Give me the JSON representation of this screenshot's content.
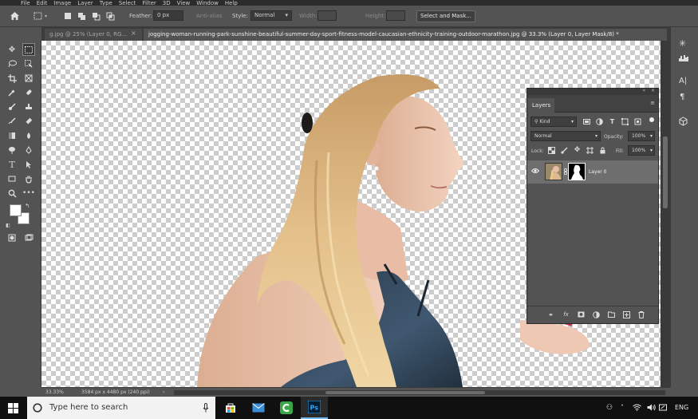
{
  "menu": [
    "File",
    "Edit",
    "Image",
    "Layer",
    "Type",
    "Select",
    "Filter",
    "3D",
    "View",
    "Window",
    "Help"
  ],
  "options": {
    "feather_label": "Feather:",
    "feather_value": "0 px",
    "antialias_label": "Anti-alias",
    "style_label": "Style:",
    "style_value": "Normal",
    "width_label": "Width:",
    "height_label": "Height:",
    "select_mask_button": "Select and Mask..."
  },
  "tabs": [
    {
      "label": "g.jpg @ 25% (Layer 0, RG..."
    },
    {
      "label": "jogging-woman-running-park-sunshine-beautiful-summer-day-sport-fitness-model-caucasian-ethnicity-training-outdoor-marathon.jpg @ 33.3% (Layer 0, Layer Mask/8) *"
    }
  ],
  "status": {
    "zoom": "33.33%",
    "doc_size": "3584 px x 4480 px (240 ppi)"
  },
  "layers_panel": {
    "title": "Layers",
    "filter_kind": "Kind",
    "blend_mode": "Normal",
    "opacity_label": "Opacity:",
    "opacity_value": "100%",
    "lock_label": "Lock:",
    "fill_label": "Fill:",
    "fill_value": "100%",
    "layer_name": "Layer 0"
  },
  "taskbar": {
    "search_placeholder": "Type here to search",
    "language": "ENG"
  },
  "colors": {
    "ui_bg": "#535353",
    "panel_dark": "#3a3a3a",
    "selected_layer": "#6e6e6e",
    "taskbar": "#101010"
  }
}
